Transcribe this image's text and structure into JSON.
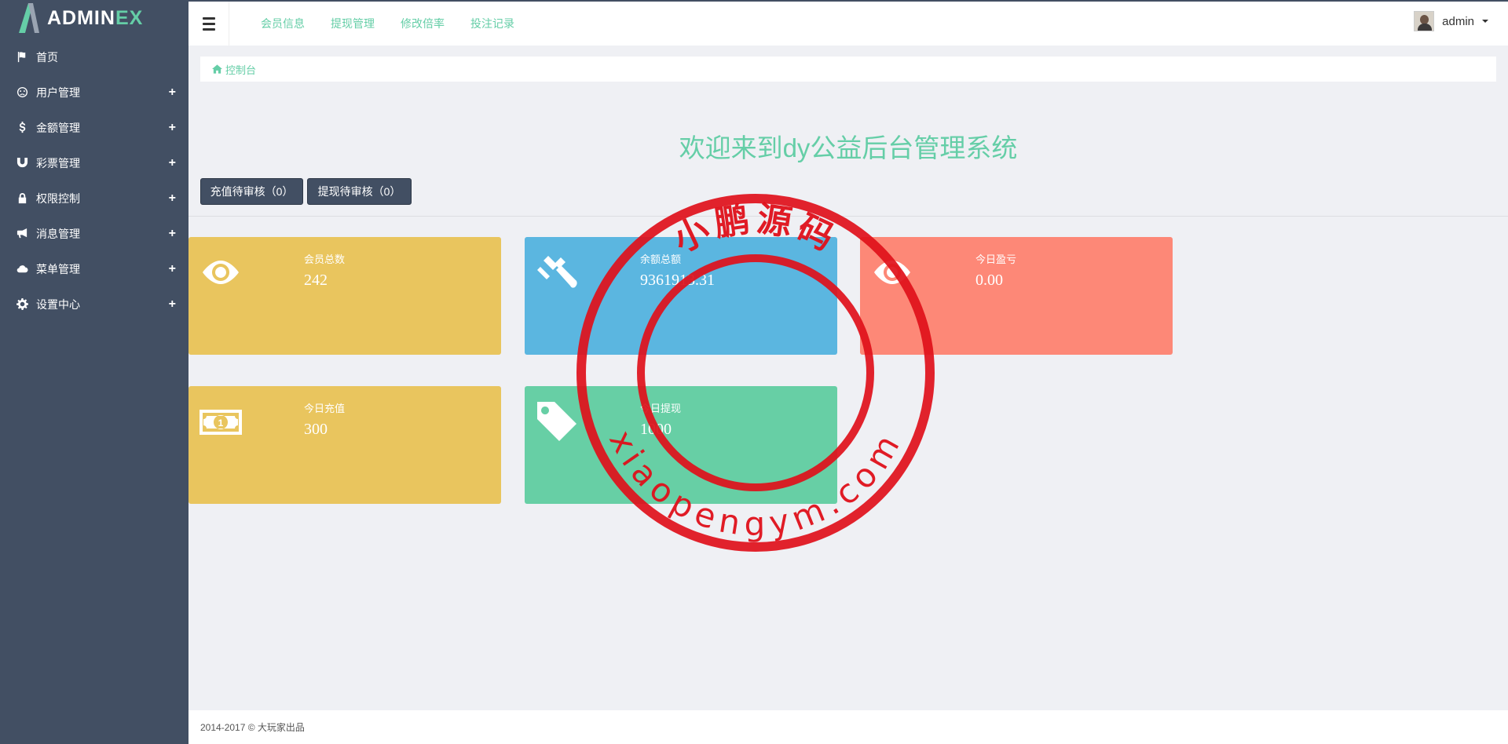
{
  "app": {
    "logo_main": "ADMIN",
    "logo_accent": "EX"
  },
  "sidebar": {
    "items": [
      {
        "label": "首页",
        "icon": "flag-icon",
        "expandable": false
      },
      {
        "label": "用户管理",
        "icon": "user-face-icon",
        "expandable": true
      },
      {
        "label": "金额管理",
        "icon": "dollar-icon",
        "expandable": true
      },
      {
        "label": "彩票管理",
        "icon": "magnet-icon",
        "expandable": true
      },
      {
        "label": "权限控制",
        "icon": "lock-icon",
        "expandable": true
      },
      {
        "label": "消息管理",
        "icon": "bullhorn-icon",
        "expandable": true
      },
      {
        "label": "菜单管理",
        "icon": "cloud-icon",
        "expandable": true
      },
      {
        "label": "设置中心",
        "icon": "gear-icon",
        "expandable": true
      }
    ],
    "expand_symbol": "+"
  },
  "topnav": {
    "links": [
      "会员信息",
      "提现管理",
      "修改倍率",
      "投注记录"
    ]
  },
  "user": {
    "name": "admin"
  },
  "breadcrumb": {
    "label": "控制台"
  },
  "welcome": {
    "title": "欢迎来到dy公益后台管理系统"
  },
  "actions": {
    "recharge_pending": "充值待审核（0）",
    "withdraw_pending": "提现待审核（0）"
  },
  "stats": [
    {
      "title": "会员总数",
      "value": "242",
      "icon": "eye-icon",
      "color": "#e9c55e"
    },
    {
      "title": "余额总额",
      "value": "9361913.31",
      "icon": "gavel-icon",
      "color": "#5bb6e0"
    },
    {
      "title": "今日盈亏",
      "value": "0.00",
      "icon": "eye-icon",
      "color": "#fd8877"
    },
    {
      "title": "今日充值",
      "value": "300",
      "icon": "money-bill-icon",
      "color": "#e9c55e"
    },
    {
      "title": "今日提现",
      "value": "1000",
      "icon": "tag-icon",
      "color": "#67cfa5"
    }
  ],
  "watermark": {
    "text_top": "小鹏源码",
    "text_bottom": "xiaopengym.com",
    "color": "#e0101a"
  },
  "footer": {
    "text": "2014-2017 © 大玩家出品"
  },
  "colors": {
    "sidebar_bg": "#424f63",
    "accent": "#65cea7",
    "page_bg": "#eff0f4"
  }
}
